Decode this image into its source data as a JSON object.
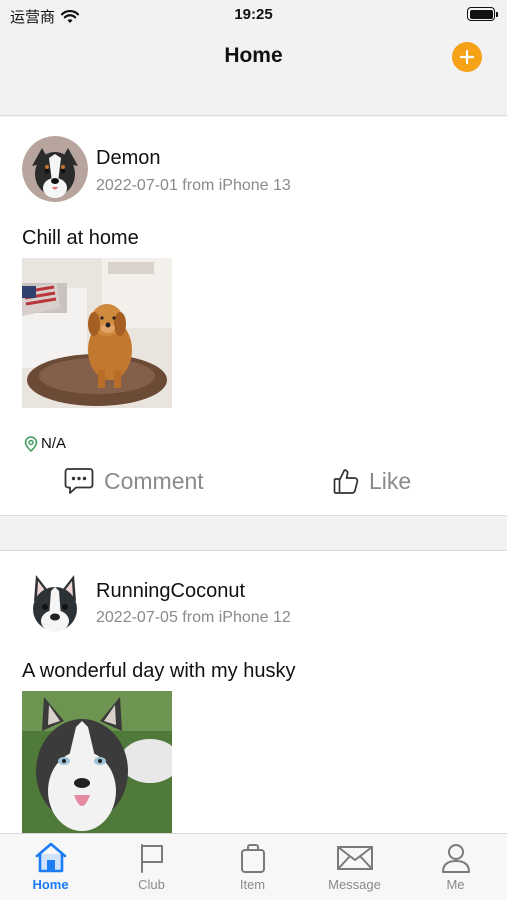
{
  "status_bar": {
    "carrier": "运营商",
    "time": "19:25"
  },
  "navbar": {
    "title": "Home"
  },
  "posts": [
    {
      "username": "Demon",
      "meta": "2022-07-01 from iPhone 13",
      "caption": "Chill at home",
      "location": "N/A",
      "comment_label": "Comment",
      "like_label": "Like"
    },
    {
      "username": "RunningCoconut",
      "meta": "2022-07-05 from iPhone 12",
      "caption": "A wonderful day with my husky"
    }
  ],
  "tabs": [
    {
      "label": "Home",
      "icon": "home-icon",
      "active": true
    },
    {
      "label": "Club",
      "icon": "flag-icon"
    },
    {
      "label": "Item",
      "icon": "bag-icon"
    },
    {
      "label": "Message",
      "icon": "envelope-icon"
    },
    {
      "label": "Me",
      "icon": "person-icon"
    }
  ],
  "colors": {
    "accent": "#f5a216",
    "tab_active": "#1b7cf3",
    "secondary_text": "#8a8a8a"
  }
}
